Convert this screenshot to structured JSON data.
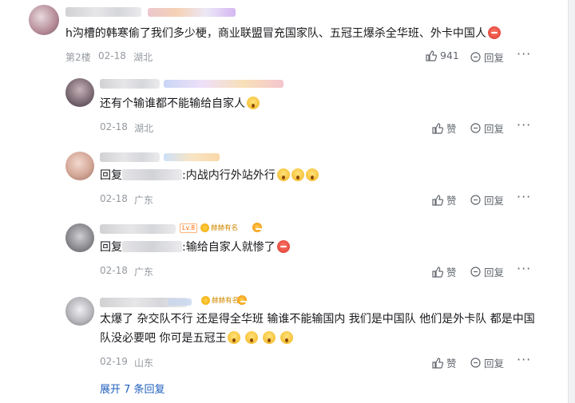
{
  "comments": [
    {
      "text": "h沟槽的韩寒偷了我们多少梗，商业联盟冒充国家队、五冠王爆杀全华班、外卡中国人",
      "floor": "第2楼",
      "date": "02-18",
      "location": "湖北",
      "likes": "941",
      "reply_label": "回复"
    },
    {
      "text": "还有个输谁都不能输给自家人",
      "date": "02-18",
      "location": "湖北",
      "like_label": "赞",
      "reply_label": "回复"
    },
    {
      "prefix": "回复",
      "text": ":内战内行外站外行",
      "date": "02-18",
      "location": "广东",
      "like_label": "赞",
      "reply_label": "回复"
    },
    {
      "prefix": "回复",
      "text": ":输给自家人就惨了",
      "level": "Lv.8",
      "badge": "赫赫有名",
      "date": "02-18",
      "location": "广东",
      "like_label": "赞",
      "reply_label": "回复"
    },
    {
      "line1": "太爆了 杂交队不行 还是得全华班 输谁不能输国内 我们是中国队 他们是外卡队 都是中国",
      "line2": "队没必要吧 你可是五冠王",
      "badge": "赫赫有名",
      "date": "02-19",
      "location": "山东",
      "like_label": "赞",
      "reply_label": "回复"
    }
  ],
  "expand_label": "展开 7 条回复",
  "colors": {
    "link": "#1f5fbf",
    "meta": "#9499a0",
    "text": "#18191c"
  }
}
